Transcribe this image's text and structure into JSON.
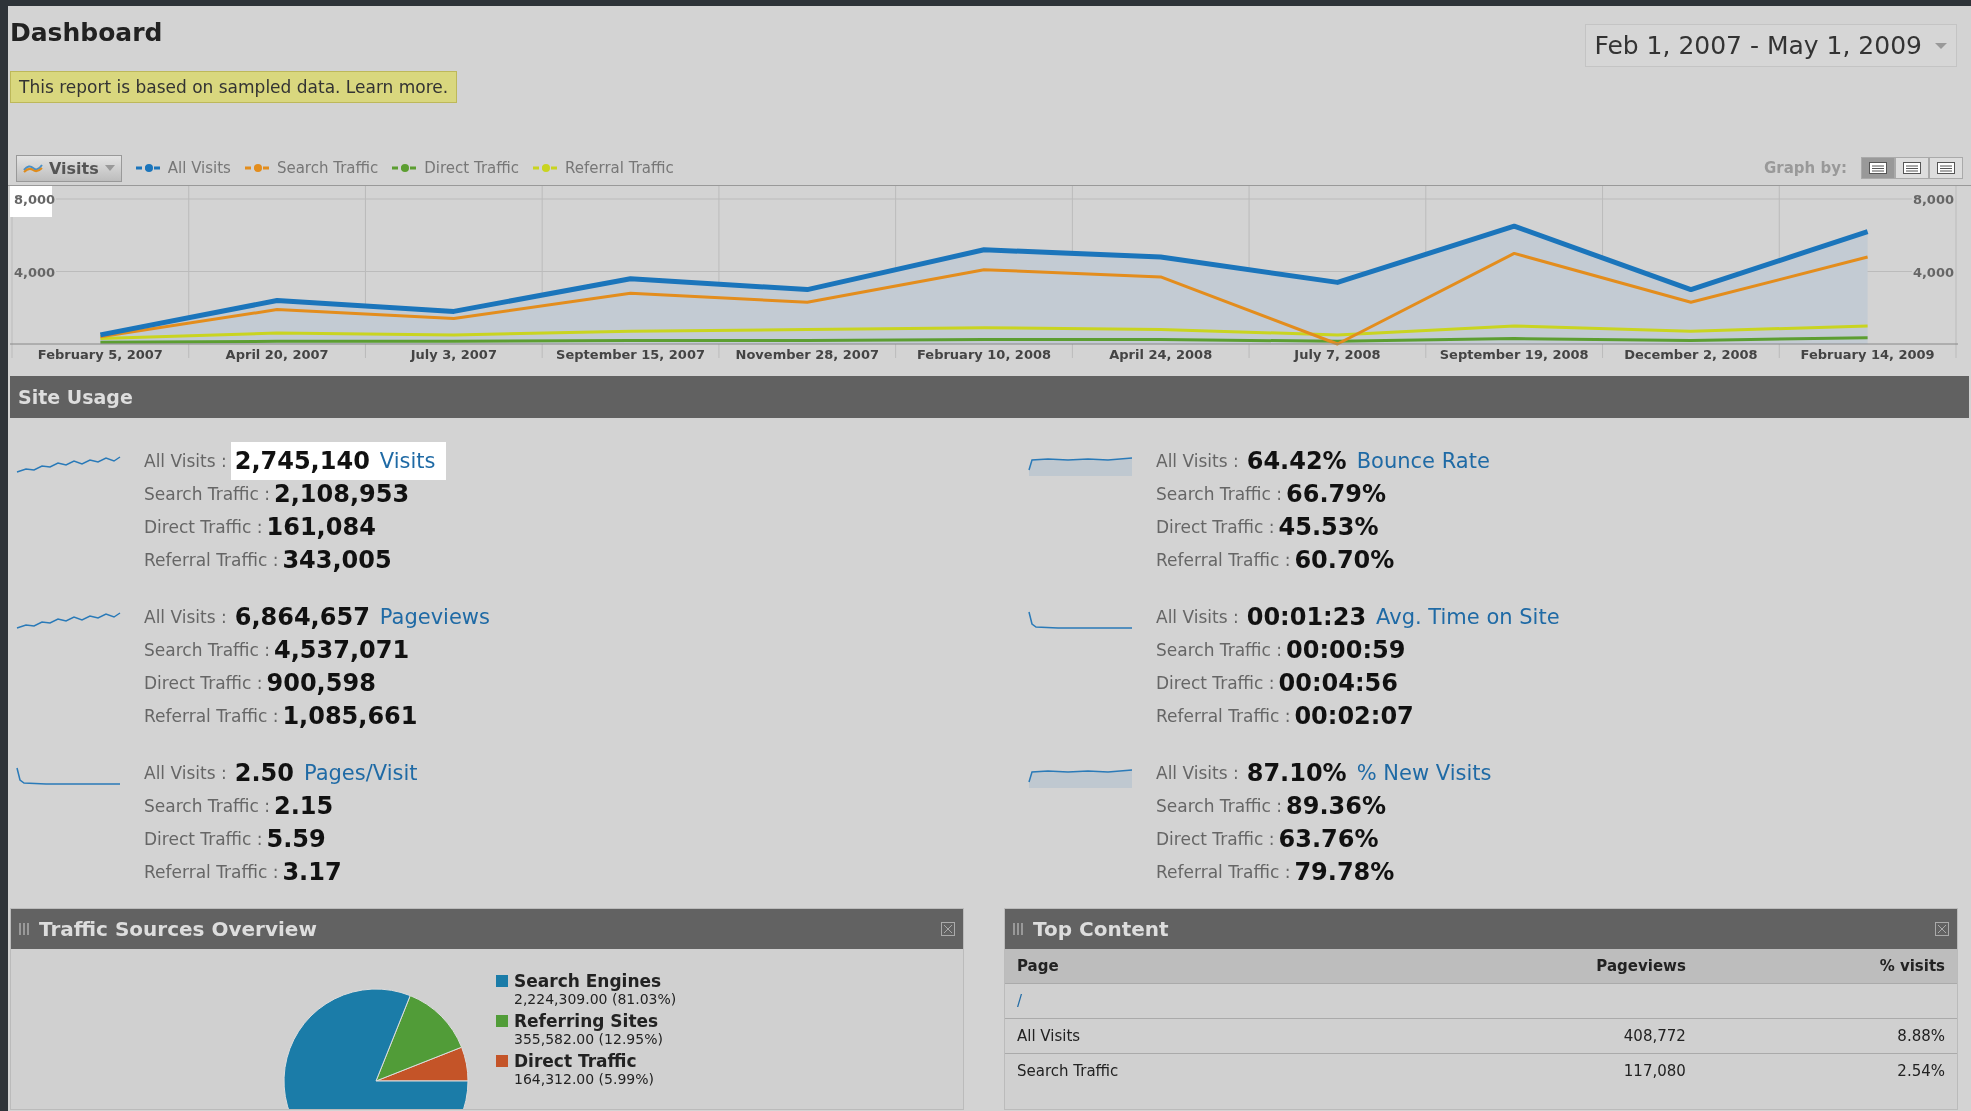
{
  "header": {
    "title": "Dashboard",
    "notice": "This report is based on sampled data. Learn more.",
    "date_range": "Feb 1, 2007 - May 1, 2009"
  },
  "graph": {
    "metric_menu": "Visits",
    "graph_by_label": "Graph by:",
    "graph_by": [
      {
        "selected": true
      },
      {
        "selected": false
      },
      {
        "selected": false
      }
    ],
    "chart_data": {
      "type": "line",
      "categories": [
        "February 5, 2007",
        "April 20, 2007",
        "July 3, 2007",
        "September 15, 2007",
        "November 28, 2007",
        "February 10, 2008",
        "April 24, 2008",
        "July 7, 2008",
        "September 19, 2008",
        "December 2, 2008",
        "February 14, 2009"
      ],
      "series": [
        {
          "name": "All Visits",
          "type": "area",
          "color": "#1b75bb",
          "values": [
            500,
            2400,
            1800,
            3600,
            3000,
            5200,
            4800,
            3400,
            6500,
            3000,
            6200
          ]
        },
        {
          "name": "Search Traffic",
          "type": "line",
          "color": "#e38d1d",
          "values": [
            400,
            1900,
            1400,
            2800,
            2300,
            4100,
            3700,
            0,
            5000,
            2300,
            4800
          ]
        },
        {
          "name": "Direct Traffic",
          "type": "line",
          "color": "#5c9e31",
          "values": [
            100,
            150,
            150,
            200,
            200,
            250,
            250,
            150,
            300,
            200,
            350
          ]
        },
        {
          "name": "Referral Traffic",
          "type": "line",
          "color": "#c9d420",
          "values": [
            300,
            600,
            500,
            700,
            800,
            900,
            800,
            500,
            1000,
            700,
            1000
          ]
        }
      ],
      "ylim": [
        0,
        8000
      ],
      "yticks": [
        {
          "value": 4000,
          "label": "4,000"
        },
        {
          "value": 8000,
          "label": "8,000"
        }
      ]
    }
  },
  "site_usage": {
    "title": "Site Usage",
    "metrics": [
      {
        "name": "Visits",
        "highlighted": true,
        "rows": [
          {
            "label": "All Visits :",
            "value": "2,745,140"
          },
          {
            "label": "Search Traffic :",
            "value": "2,108,953"
          },
          {
            "label": "Direct Traffic :",
            "value": "161,084"
          },
          {
            "label": "Referral Traffic :",
            "value": "343,005"
          }
        ]
      },
      {
        "name": "Bounce Rate",
        "highlighted": false,
        "rows": [
          {
            "label": "All Visits :",
            "value": "64.42%"
          },
          {
            "label": "Search Traffic :",
            "value": "66.79%"
          },
          {
            "label": "Direct Traffic :",
            "value": "45.53%"
          },
          {
            "label": "Referral Traffic :",
            "value": "60.70%"
          }
        ]
      },
      {
        "name": "Pageviews",
        "highlighted": false,
        "rows": [
          {
            "label": "All Visits :",
            "value": "6,864,657"
          },
          {
            "label": "Search Traffic :",
            "value": "4,537,071"
          },
          {
            "label": "Direct Traffic :",
            "value": "900,598"
          },
          {
            "label": "Referral Traffic :",
            "value": "1,085,661"
          }
        ]
      },
      {
        "name": "Avg. Time on Site",
        "highlighted": false,
        "rows": [
          {
            "label": "All Visits :",
            "value": "00:01:23"
          },
          {
            "label": "Search Traffic :",
            "value": "00:00:59"
          },
          {
            "label": "Direct Traffic :",
            "value": "00:04:56"
          },
          {
            "label": "Referral Traffic :",
            "value": "00:02:07"
          }
        ]
      },
      {
        "name": "Pages/Visit",
        "highlighted": false,
        "rows": [
          {
            "label": "All Visits :",
            "value": "2.50"
          },
          {
            "label": "Search Traffic :",
            "value": "2.15"
          },
          {
            "label": "Direct Traffic :",
            "value": "5.59"
          },
          {
            "label": "Referral Traffic :",
            "value": "3.17"
          }
        ]
      },
      {
        "name": "% New Visits",
        "highlighted": false,
        "rows": [
          {
            "label": "All Visits :",
            "value": "87.10%"
          },
          {
            "label": "Search Traffic :",
            "value": "89.36%"
          },
          {
            "label": "Direct Traffic :",
            "value": "63.76%"
          },
          {
            "label": "Referral Traffic :",
            "value": "79.78%"
          }
        ]
      }
    ]
  },
  "traffic_sources": {
    "title": "Traffic Sources Overview",
    "chart_data": {
      "type": "pie",
      "categories": [
        "Search Engines",
        "Referring Sites",
        "Direct Traffic"
      ],
      "values": [
        81.03,
        12.95,
        5.99
      ]
    },
    "legend": [
      {
        "value": "2,224,309.00 (81.03%)",
        "color": "#1b7ca8"
      },
      {
        "value": "355,582.00 (12.95%)",
        "color": "#519c38"
      },
      {
        "value": "164,312.00 (5.99%)",
        "color": "#c45428"
      }
    ]
  },
  "top_content": {
    "title": "Top Content",
    "columns": [
      "Page",
      "Pageviews",
      "% visits"
    ],
    "rows": [
      {
        "kind": "page",
        "cells": [
          "/"
        ]
      },
      {
        "kind": "segment",
        "cells": [
          "All Visits",
          "408,772",
          "8.88%"
        ]
      },
      {
        "kind": "segment",
        "cells": [
          "Search Traffic",
          "117,080",
          "2.54%"
        ]
      }
    ]
  }
}
